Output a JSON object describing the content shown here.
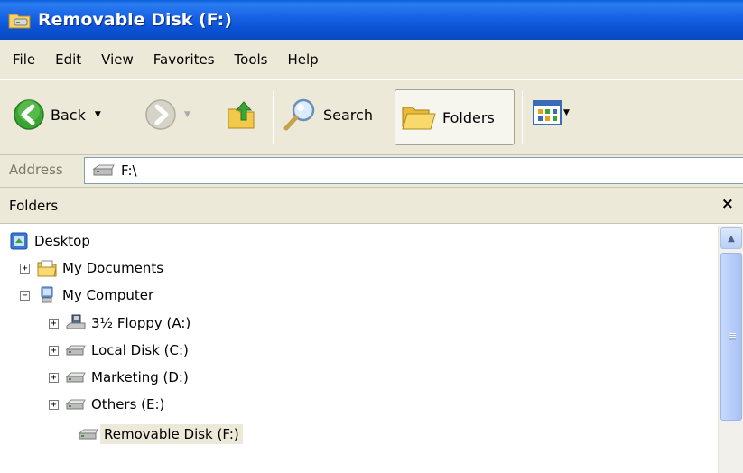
{
  "window": {
    "title": "Removable Disk (F:)",
    "icon": "drive-folder-icon"
  },
  "menu": [
    "File",
    "Edit",
    "View",
    "Favorites",
    "Tools",
    "Help"
  ],
  "toolbar": {
    "back_label": "Back",
    "search_label": "Search",
    "folders_label": "Folders"
  },
  "address": {
    "label": "Address",
    "value": "F:\\"
  },
  "folders_pane": {
    "title": "Folders",
    "close": "×"
  },
  "tree": {
    "desktop": "Desktop",
    "my_documents": "My Documents",
    "my_computer": "My Computer",
    "floppy": "3½ Floppy (A:)",
    "local_disk": "Local Disk (C:)",
    "marketing": "Marketing (D:)",
    "others": "Others (E:)",
    "removable": "Removable Disk (F:)"
  },
  "expanders": {
    "plus": "+",
    "minus": "−"
  },
  "colors": {
    "titlebar": "#0b53d6",
    "chrome": "#ece9d8",
    "selection": "#ece9d8"
  }
}
